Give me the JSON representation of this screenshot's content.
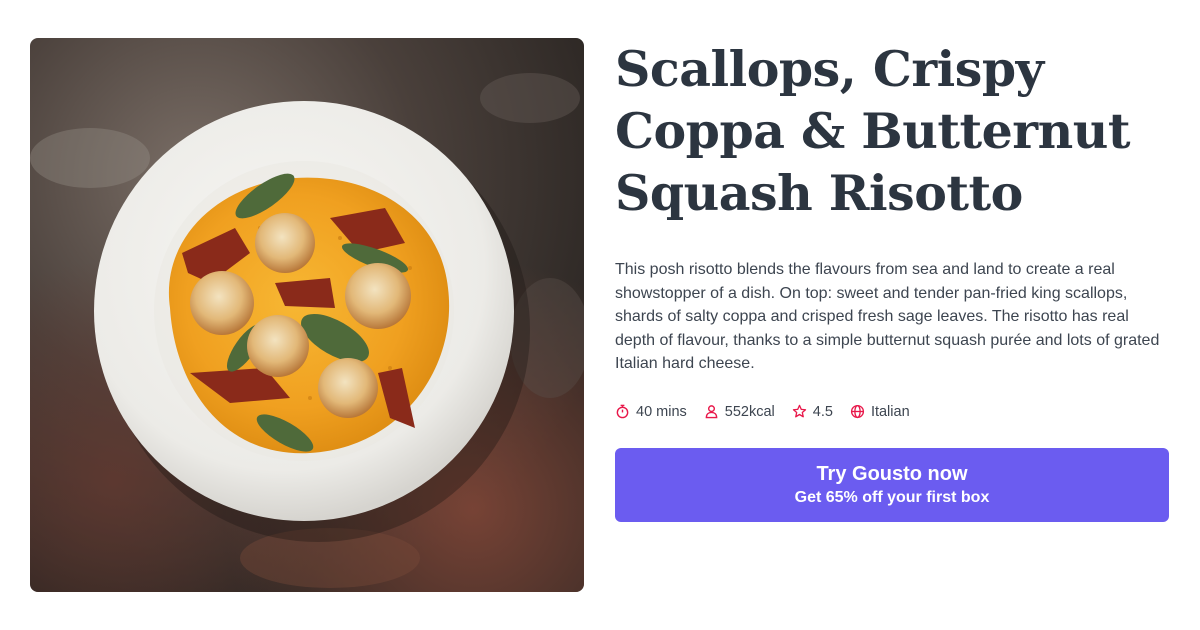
{
  "recipe": {
    "title": "Scallops, Crispy Coppa & Butternut Squash Risotto",
    "description": "This posh risotto blends the flavours from sea and land to create a real showstopper of a dish. On top: sweet and tender pan-fried king scallops, shards of salty coppa and crisped fresh sage leaves. The risotto has real depth of flavour, thanks to a simple butternut squash purée and lots of grated Italian hard cheese.",
    "meta": {
      "time": "40 mins",
      "time_icon": "stopwatch-icon",
      "calories": "552kcal",
      "calories_icon": "person-icon",
      "rating": "4.5",
      "rating_icon": "star-icon",
      "cuisine": "Italian",
      "cuisine_icon": "globe-icon"
    }
  },
  "cta": {
    "label": "Try Gousto now",
    "sublabel": "Get 65% off your first box"
  },
  "colors": {
    "accent": "#e8184a",
    "button": "#6b5cf0",
    "title": "#2c3540",
    "body_text": "#3d4550"
  }
}
